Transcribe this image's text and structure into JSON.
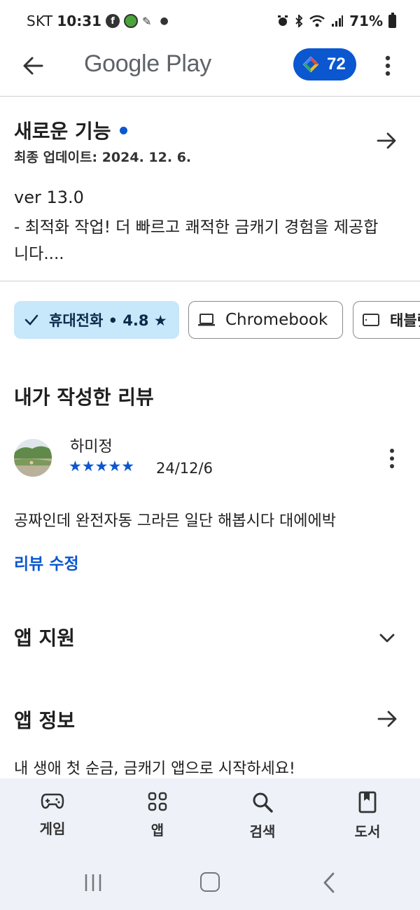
{
  "status_bar": {
    "carrier": "SKT",
    "time": "10:31",
    "battery": "71%"
  },
  "top_bar": {
    "title": "Google Play",
    "points": "72"
  },
  "whats_new": {
    "title": "새로운 기능",
    "updated": "최종 업데이트: 2024. 12. 6.",
    "version": "ver 13.0",
    "note": "- 최적화 작업! 더 빠르고 쾌적한 금캐기 경험을 제공합니다...."
  },
  "device_chips": {
    "phone": "휴대전화 • 4.8 ★",
    "chromebook": "Chromebook",
    "tablet": "태블릿"
  },
  "my_review": {
    "title": "내가 작성한 리뷰",
    "reviewer": "하미정",
    "rating": 5,
    "stars": "★★★★★",
    "date": "24/12/6",
    "text": "공짜인데 완전자동 그라믄 일단 해봅시다 대에에박",
    "edit_label": "리뷰 수정"
  },
  "app_support": {
    "title": "앱 지원"
  },
  "app_info": {
    "title": "앱 정보",
    "description": "내 생애 첫 순금, 금캐기 앱으로 시작하세요!"
  },
  "bottom_nav": {
    "games": "게임",
    "apps": "앱",
    "search": "검색",
    "books": "도서"
  },
  "colors": {
    "accent": "#0b57d0",
    "chip_selected": "#c7e7fa",
    "nav_bg": "#eef1f8"
  }
}
